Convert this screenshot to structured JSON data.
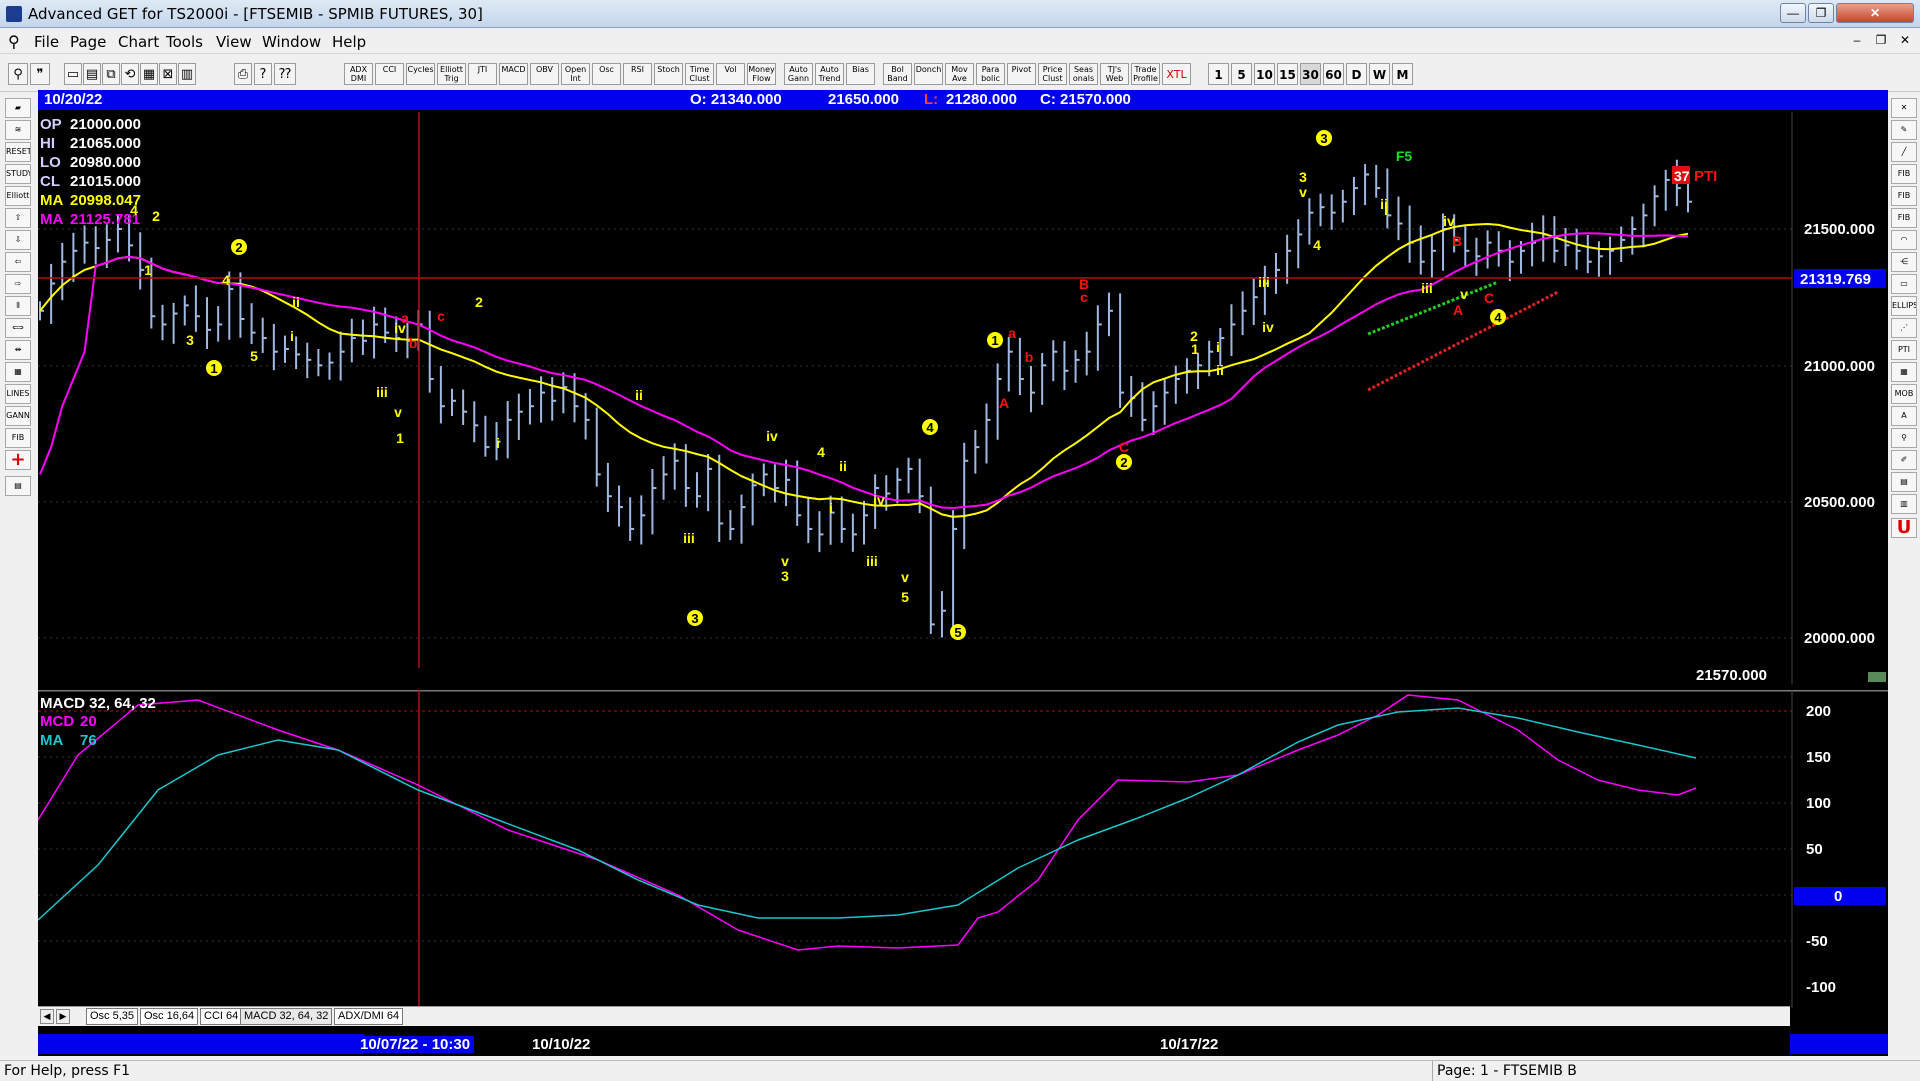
{
  "window": {
    "title": "Advanced GET for TS2000i - [FTSEMIB - SPMIB FUTURES, 30]"
  },
  "menu": [
    "File",
    "Page",
    "Chart",
    "Tools",
    "View",
    "Window",
    "Help"
  ],
  "toolbar": {
    "studies": [
      "ADX DMI",
      "CCI",
      "Cycles",
      "Elliott Trig",
      "JTI",
      "MACD",
      "OBV",
      "Open Int",
      "Osc",
      "RSI",
      "Stoch",
      "Time Clust",
      "Vol",
      "Money Flow",
      "Auto Gann",
      "Auto Trend",
      "Bias",
      "Bol Band",
      "Donch",
      "Mov Ave",
      "Para bolic",
      "Pivot",
      "Price Clust",
      "Seas onals",
      "TJ's Web",
      "Trade Profile",
      "XTL"
    ],
    "intervals": [
      "1",
      "5",
      "10",
      "15",
      "30",
      "60",
      "D",
      "W",
      "M"
    ],
    "active_interval": "30"
  },
  "left_toolbar": [
    "RESET",
    "STUDY",
    "Elliott",
    "LINES",
    "GANN",
    "FIB"
  ],
  "right_toolbar": [
    "FIB RET",
    "FIB EXT",
    "FIB TIME",
    "ELLIPS",
    "PTI",
    "MOB"
  ],
  "info_bar": {
    "date": "10/20/22",
    "open": "O: 21340.000",
    "high": "21650.000",
    "low_label": "L:",
    "low": "21280.000",
    "close": "C: 21570.000"
  },
  "data_panel": {
    "op": {
      "label": "OP",
      "value": "21000.000"
    },
    "hi": {
      "label": "HI",
      "value": "21065.000"
    },
    "lo": {
      "label": "LO",
      "value": "20980.000"
    },
    "cl": {
      "label": "CL",
      "value": "21015.000"
    },
    "ma1": {
      "label": "MA",
      "value": "20998.047"
    },
    "ma2": {
      "label": "MA",
      "value": "21125.781"
    }
  },
  "main_chart": {
    "y_ticks": [
      "21500.000",
      "21000.000",
      "20500.000",
      "20000.000"
    ],
    "crosshair_price": "21319.769",
    "last_price": "21570.000",
    "pti": {
      "value": "37",
      "label": "PTI"
    },
    "colors": {
      "price_bar": "#9fb9e2",
      "ma_fast": "#ffff00",
      "ma_slow": "#ff00ff",
      "wave": "#ffff00",
      "wave_red": "#ff1010"
    },
    "labels": {
      "y": [
        {
          "t": "4"
        },
        {
          "t": "2"
        },
        {
          "t": "1"
        },
        {
          "t": "3"
        },
        {
          "t": "4"
        },
        {
          "t": "5"
        },
        {
          "t": "ii"
        },
        {
          "t": "i"
        },
        {
          "t": "iii"
        },
        {
          "t": "v"
        },
        {
          "t": "1"
        },
        {
          "t": "iv"
        },
        {
          "t": "2"
        },
        {
          "t": "i"
        },
        {
          "t": "ii"
        },
        {
          "t": "iii"
        },
        {
          "t": "iv"
        },
        {
          "t": "3"
        },
        {
          "t": "v"
        },
        {
          "t": "4"
        },
        {
          "t": "i"
        },
        {
          "t": "ii"
        },
        {
          "t": "iv"
        },
        {
          "t": "iii"
        },
        {
          "t": "v"
        },
        {
          "t": "5"
        },
        {
          "t": "2"
        },
        {
          "t": "i"
        },
        {
          "t": "ii"
        },
        {
          "t": "1"
        },
        {
          "t": "iii"
        },
        {
          "t": "iv"
        },
        {
          "t": "3"
        },
        {
          "t": "v"
        },
        {
          "t": "4"
        },
        {
          "t": "i"
        },
        {
          "t": "ii"
        },
        {
          "t": "iii"
        },
        {
          "t": "iv"
        },
        {
          "t": "v"
        }
      ],
      "circled": [
        {
          "t": "2"
        },
        {
          "t": "1"
        },
        {
          "t": "4"
        },
        {
          "t": "3"
        },
        {
          "t": "5"
        },
        {
          "t": "1"
        },
        {
          "t": "2"
        },
        {
          "t": "3"
        },
        {
          "t": "4"
        }
      ],
      "red": [
        {
          "t": "a"
        },
        {
          "t": "b"
        },
        {
          "t": "c"
        },
        {
          "t": "a"
        },
        {
          "t": "b"
        },
        {
          "t": "A"
        },
        {
          "t": "B"
        },
        {
          "t": "c"
        },
        {
          "t": "C"
        },
        {
          "t": "B"
        },
        {
          "t": "A"
        },
        {
          "t": "C"
        }
      ],
      "green": [
        {
          "t": "F5"
        }
      ]
    }
  },
  "series_points": {
    "close": [
      21200,
      21300,
      21380,
      21420,
      21450,
      21430,
      21460,
      21500,
      21440,
      21350,
      21180,
      21150,
      21190,
      21220,
      21180,
      21130,
      21150,
      21280,
      21170,
      21120,
      21100,
      21050,
      21060,
      21040,
      21020,
      21000,
      21010,
      21050,
      21100,
      21090,
      21150,
      21120,
      21100,
      21090,
      21150,
      20950,
      20850,
      20870,
      20830,
      20780,
      20700,
      20720,
      20800,
      20830,
      20850,
      20900,
      20870,
      20920,
      20850,
      20800,
      20600,
      20520,
      20480,
      20400,
      20450,
      20550,
      20600,
      20650,
      20550,
      20520,
      20620,
      20420,
      20400,
      20480,
      20560,
      20600,
      20550,
      20580,
      20450,
      20400,
      20380,
      20460,
      20400,
      20380,
      20450,
      20550,
      20530,
      20580,
      20620,
      20520,
      20050,
      20100,
      20400,
      20650,
      20700,
      20800,
      20950,
      21050,
      20950,
      20900,
      21000,
      21050,
      20980,
      21020,
      21050,
      21150,
      21200,
      20900,
      20880,
      20800,
      20850,
      20900,
      20950,
      20980,
      21000,
      21050,
      21100,
      21150,
      21200,
      21250,
      21300,
      21350,
      21420,
      21480,
      21560,
      21580,
      21560,
      21600,
      21650,
      21700,
      21650,
      21550,
      21520,
      21450,
      21380,
      21420,
      21500,
      21460,
      21420,
      21400,
      21450,
      21420,
      21380,
      21420,
      21450,
      21480,
      21420,
      21440,
      21420,
      21380,
      21400,
      21420,
      21460,
      21500,
      21550,
      21620,
      21680,
      21650,
      21600
    ]
  },
  "macd_panel": {
    "title": "MACD 32, 64, 32",
    "line1": {
      "label": "MCD",
      "value": "20"
    },
    "line2": {
      "label": "MA",
      "value": "76"
    },
    "y_ticks": [
      "200",
      "150",
      "100",
      "50",
      "0",
      "-50",
      "-100"
    ],
    "zero_value": "0"
  },
  "tabs": [
    "Osc 5,35",
    "Osc 16,64",
    "CCI 64",
    "MACD 32, 64, 32",
    "ADX/DMI 64"
  ],
  "active_tab": "MACD 32, 64, 32",
  "date_axis": {
    "cursor_date": "10/07/22 - 10:30",
    "d1": "10/10/22",
    "d2": "10/17/22"
  },
  "status": {
    "left": "For Help, press F1",
    "right": "Page: 1 - FTSEMIB B"
  }
}
